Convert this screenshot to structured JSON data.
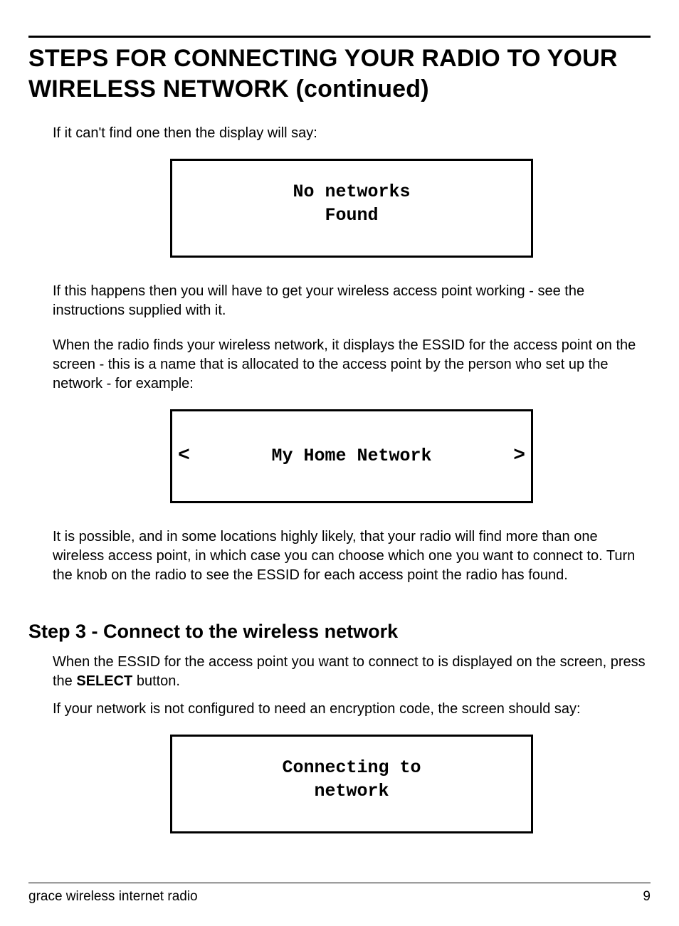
{
  "header": {
    "title_line1": "STEPS FOR CONNECTING YOUR RADIO TO YOUR",
    "title_line2": "WIRELESS NETWORK (continued)"
  },
  "section1": {
    "p1": "If it can't find one then the display will say:",
    "display1_line1": "No networks",
    "display1_line2": "Found",
    "p2": "If this happens then you will have to get your wireless access point working - see the instructions supplied with it.",
    "p3": "When the radio finds your wireless network, it displays the ESSID for the access point on the screen - this is a name that is allocated to the access point by the person who set up the network - for example:",
    "display2_left": "<",
    "display2_center": "My Home Network",
    "display2_right": ">",
    "p4": "It is possible, and in some locations highly likely, that your radio will find more than one wireless access point, in which case you can choose which one you want to connect to. Turn the knob on the radio to see the ESSID for each access point the radio has found."
  },
  "section2": {
    "heading": "Step 3 - Connect to the wireless network",
    "p1_a": "When the ESSID for the access point you want to connect to is displayed on the screen, press the ",
    "p1_bold": "SELECT",
    "p1_b": " button.",
    "p2": "If your network is not configured to need an encryption code, the screen should say:",
    "display3_line1": "Connecting to",
    "display3_line2": "network"
  },
  "footer": {
    "left": "grace wireless internet radio",
    "right": "9"
  }
}
